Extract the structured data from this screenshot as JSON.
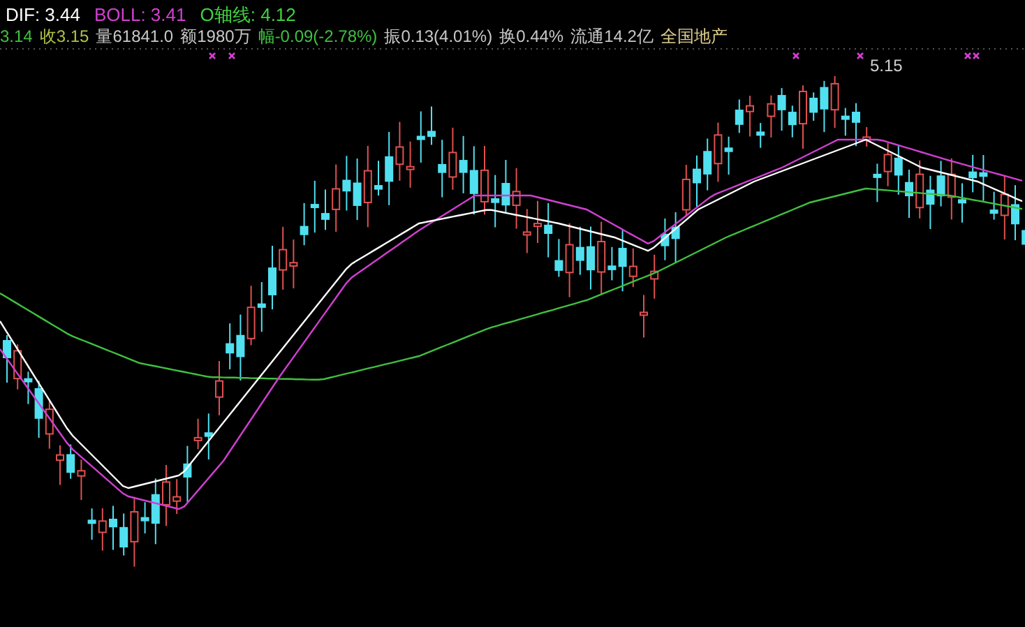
{
  "legend": [
    {
      "label": "DIF: 3.44",
      "color": "#ffffff"
    },
    {
      "label": "BOLL: 3.41",
      "color": "#d040d0"
    },
    {
      "label": "O轴线: 4.12",
      "color": "#40d040"
    }
  ],
  "info_line": [
    {
      "text": "3.14",
      "color": "#40c040"
    },
    {
      "text": "收3.15",
      "color": "#b0c040"
    },
    {
      "text": "量61841.0",
      "color": "#c8c8c8"
    },
    {
      "text": "额1980万",
      "color": "#c8c8c8"
    },
    {
      "text": "幅-0.09(-2.78%)",
      "color": "#40c040"
    },
    {
      "text": "振0.13(4.01%)",
      "color": "#c8c8c8"
    },
    {
      "text": "换0.44%",
      "color": "#c8c8c8"
    },
    {
      "text": "流通14.2亿",
      "color": "#c8c8c8"
    },
    {
      "text": "全国地产",
      "color": "#e0d090"
    }
  ],
  "chart": {
    "high_label": "5.15"
  }
}
